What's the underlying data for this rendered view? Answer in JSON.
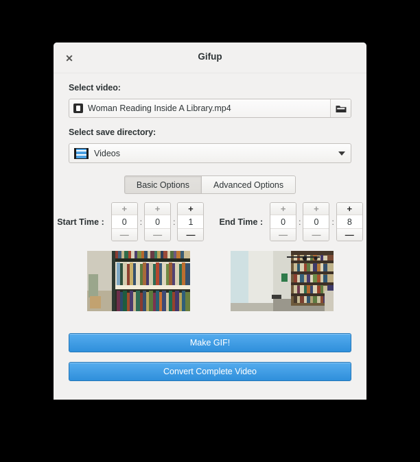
{
  "window": {
    "title": "Gifup",
    "close_label": "✕"
  },
  "video_section": {
    "label": "Select video:",
    "file_name": "Woman Reading Inside A Library.mp4",
    "file_icon": "video-file-icon",
    "browse_icon": "folder-icon"
  },
  "directory_section": {
    "label": "Select save directory:",
    "selected": "Videos",
    "icon": "film-strip-icon",
    "caret_icon": "chevron-down-icon"
  },
  "tabs": [
    {
      "label": "Basic Options",
      "active": true
    },
    {
      "label": "Advanced Options",
      "active": false
    }
  ],
  "time": {
    "start_label": "Start Time :",
    "end_label": "End Time :",
    "separator": ":",
    "increment_label": "+",
    "decrement_label": "—",
    "start_values": [
      "0",
      "0",
      "1"
    ],
    "end_values": [
      "0",
      "0",
      "8"
    ]
  },
  "previews": [
    {
      "name": "start-frame-preview",
      "alt": "Library bookshelf with colorful book spines"
    },
    {
      "name": "end-frame-preview",
      "alt": "Library aisle with tall shelves and exit sign"
    }
  ],
  "actions": [
    {
      "label": "Make GIF!",
      "name": "make-gif-button"
    },
    {
      "label": "Convert Complete Video",
      "name": "convert-complete-video-button"
    }
  ],
  "colors": {
    "accent": "#3b95dd",
    "window_bg": "#f2f1f0",
    "text": "#2e3436",
    "backdrop": "#000000"
  }
}
